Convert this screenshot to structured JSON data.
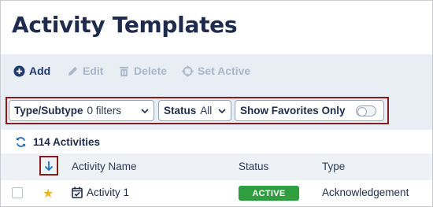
{
  "page": {
    "title": "Activity Templates"
  },
  "toolbar": {
    "add_label": "Add",
    "edit_label": "Edit",
    "delete_label": "Delete",
    "set_active_label": "Set Active"
  },
  "filters": {
    "type_subtype": {
      "label": "Type/Subtype",
      "value": "0 filters"
    },
    "status": {
      "label": "Status",
      "value": "All"
    },
    "favorites": {
      "label": "Show Favorites Only",
      "enabled": false
    }
  },
  "summary": {
    "count_label": "114 Activities"
  },
  "table": {
    "columns": [
      "Activity Name",
      "Status",
      "Type"
    ],
    "rows": [
      {
        "name": "Activity 1",
        "status": "ACTIVE",
        "type": "Acknowledgement",
        "favorite": true,
        "selected": false
      }
    ]
  },
  "colors": {
    "accent": "#1e3a6e",
    "disabled": "#a9b7c9",
    "highlight_border": "#8b1a1a",
    "active_badge": "#2e9e3e",
    "favorite_star": "#f0b429"
  }
}
